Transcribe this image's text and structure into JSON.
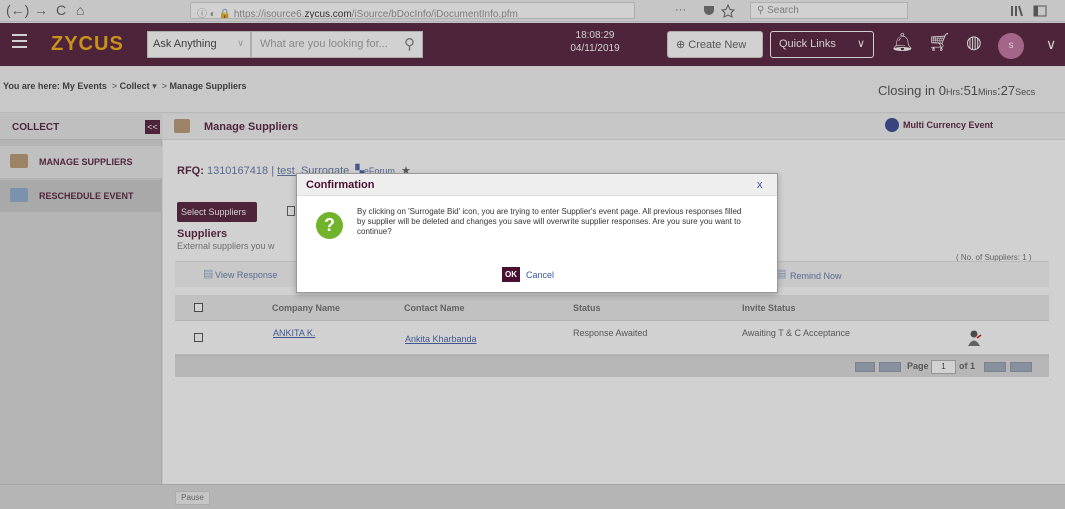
{
  "browser": {
    "url_prefix": "https://isource6.",
    "url_domain": "zycus.com",
    "url_path": "/iSource/bDocInfo/iDocumentInfo.pfm",
    "search_placeholder": "Search",
    "nav_back": "(←)",
    "nav_forward": "→",
    "nav_reload": "C",
    "nav_home": "⌂",
    "menu_dots": "···",
    "url_security": "ⓘ ◐ 🔒"
  },
  "header": {
    "logo": "ZYCUS",
    "ask_label": "Ask Anything",
    "search_placeholder": "What are you looking for...",
    "time": "18:08:29",
    "date": "04/11/2019",
    "create_new": "Create New",
    "quick_links": "Quick Links",
    "avatar_initial": "s"
  },
  "breadcrumb": {
    "prefix": "You are here:",
    "item1": "My Events",
    "item2": "Collect",
    "item3": "Manage Suppliers"
  },
  "closing": {
    "label": "Closing in",
    "hrs": "0",
    "hrs_unit": "Hrs",
    "mins": ":51",
    "mins_unit": "Mins",
    "secs": ":27",
    "secs_unit": "Secs"
  },
  "sidebar": {
    "heading": "COLLECT",
    "collapse": "<<",
    "items": [
      {
        "label": "MANAGE SUPPLIERS"
      },
      {
        "label": "RESCHEDULE EVENT"
      }
    ]
  },
  "main": {
    "title": "Manage Suppliers",
    "multi_currency": "Multi Currency Event",
    "rfq_label": "RFQ:",
    "rfq_number": "1310167418",
    "rfq_sep": "|",
    "rfq_name": "test_Surrogate",
    "eforum": "eForum",
    "select_suppliers": "Select Suppliers",
    "suppliers_title": "Suppliers",
    "suppliers_sub": "External suppliers you w",
    "num_suppliers": "( No. of Suppliers: 1 )",
    "view_response": "View Response",
    "remind_now": "Remind Now"
  },
  "table": {
    "headers": [
      "Company Name",
      "Contact Name",
      "Status",
      "Invite Status"
    ],
    "rows": [
      {
        "company": "ANKITA K.",
        "contact": "Ankita Kharbanda",
        "status": "Response Awaited",
        "invite": "Awaiting T & C Acceptance"
      }
    ],
    "pager_label": "Page",
    "pager_value": "1",
    "pager_of": "of 1"
  },
  "footer": {
    "pause": "Pause"
  },
  "dialog": {
    "title": "Confirmation",
    "close": "x",
    "message": "By clicking on 'Surrogate Bid' icon, you are trying to enter Supplier's event page. All previous responses filled by supplier will be deleted and changes you save will overwrite supplier responses. Are you sure you want to continue?",
    "ok": "OK",
    "cancel": "Cancel"
  },
  "colors": {
    "brand": "#4a1030",
    "logo": "#f5a800",
    "link": "#3a57a6",
    "question_icon": "#72b32c"
  }
}
